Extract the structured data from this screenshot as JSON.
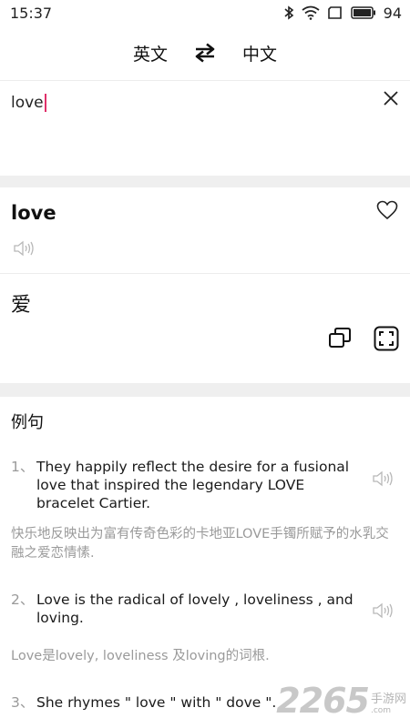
{
  "status": {
    "time": "15:37",
    "battery": "94"
  },
  "lang": {
    "source": "英文",
    "target": "中文"
  },
  "input": {
    "value": "love"
  },
  "result": {
    "word": "love",
    "translation": "爱"
  },
  "examples": {
    "title": "例句",
    "items": [
      {
        "num": "1、",
        "en": "They happily reflect the desire for a fusional love that inspired the legendary LOVE bracelet Cartier.",
        "cn": "快乐地反映出为富有传奇色彩的卡地亚LOVE手镯所赋予的水乳交融之爱恋情愫."
      },
      {
        "num": "2、",
        "en": "Love is the radical of lovely , loveliness , and loving.",
        "cn": "Love是lovely, loveliness 及loving的词根."
      },
      {
        "num": "3、",
        "en": "She rhymes \" love \" with \" dove \".",
        "cn": ""
      }
    ]
  },
  "watermark": {
    "number": "2265",
    "text": "手游网",
    "sub": ".com"
  },
  "colors": {
    "caret": "#e0306a",
    "band": "#efefef",
    "muted": "#9a9a9a"
  }
}
